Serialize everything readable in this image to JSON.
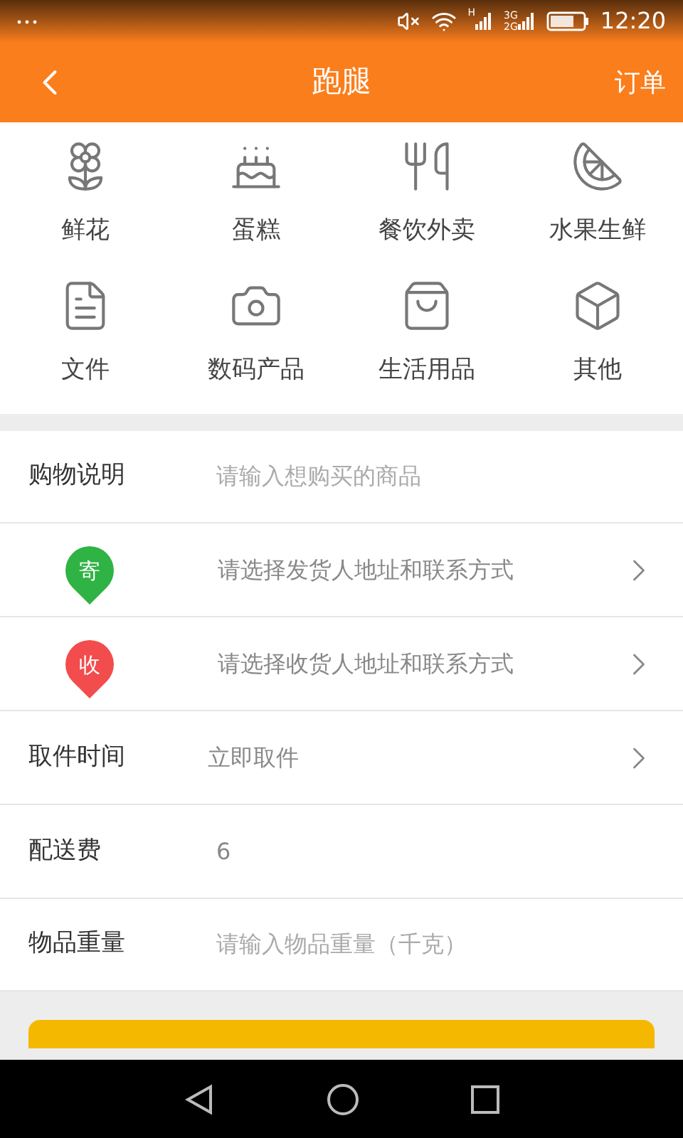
{
  "status_bar": {
    "network_h": "H",
    "network_3g": "3G",
    "network_2g": "2G",
    "time": "12:20"
  },
  "header": {
    "title": "跑腿",
    "action": "订单"
  },
  "categories": [
    {
      "label": "鲜花"
    },
    {
      "label": "蛋糕"
    },
    {
      "label": "餐饮外卖"
    },
    {
      "label": "水果生鲜"
    },
    {
      "label": "文件"
    },
    {
      "label": "数码产品"
    },
    {
      "label": "生活用品"
    },
    {
      "label": "其他"
    }
  ],
  "form": [
    {
      "kind": "input",
      "label": "购物说明",
      "placeholder": "请输入想购买的商品"
    },
    {
      "kind": "address",
      "badge": "寄",
      "color": "#2fb344",
      "placeholder": "请选择发货人地址和联系方式"
    },
    {
      "kind": "address",
      "badge": "收",
      "color": "#f24c4c",
      "placeholder": "请选择收货人地址和联系方式"
    },
    {
      "kind": "select",
      "label": "取件时间",
      "value": "立即取件"
    },
    {
      "kind": "value",
      "label": "配送费",
      "value": "6"
    },
    {
      "kind": "input",
      "label": "物品重量",
      "placeholder": "请输入物品重量（千克）"
    }
  ]
}
